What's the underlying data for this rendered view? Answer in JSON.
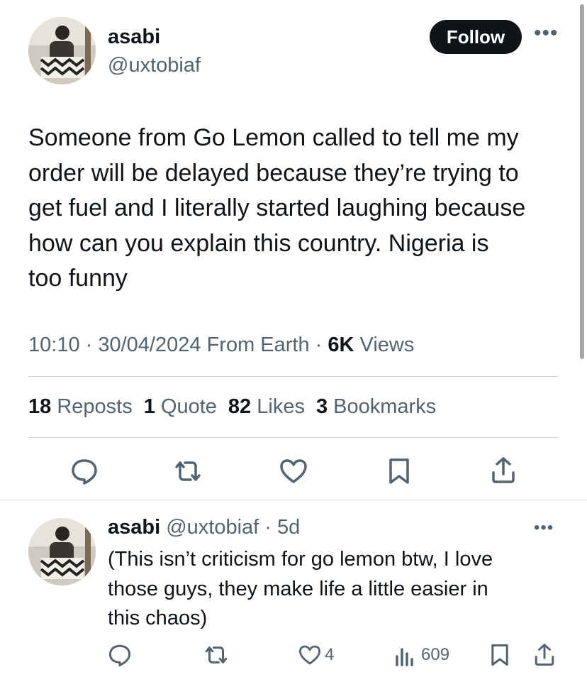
{
  "tweet": {
    "name": "asabi",
    "handle": "@uxtobiaf",
    "follow_label": "Follow",
    "text": "Someone from Go Lemon called to tell me my\norder will be delayed because they’re trying to\nget fuel and I literally started laughing because\nhow can you explain this country. Nigeria is\ntoo funny",
    "time": "10:10",
    "date": "30/04/2024",
    "source": "From Earth",
    "views_count": "6K",
    "views_label": "Views",
    "stats": {
      "reposts_count": "18",
      "reposts_label": "Reposts",
      "quotes_count": "1",
      "quotes_label": "Quote",
      "likes_count": "82",
      "likes_label": "Likes",
      "bookmarks_count": "3",
      "bookmarks_label": "Bookmarks"
    }
  },
  "reply": {
    "name": "asabi",
    "handle": "@uxtobiaf",
    "age": "5d",
    "text": "(This isn’t criticism for go lemon btw, I love\nthose guys, they make life  a little easier in\nthis chaos)",
    "likes": "4",
    "views": "609"
  },
  "colors": {
    "primary_text": "#0f1419",
    "secondary_text": "#536471",
    "divider": "#cfd9de"
  },
  "icons": [
    "reply-icon",
    "repost-icon",
    "like-icon",
    "bookmark-icon",
    "share-icon",
    "views-icon",
    "more-icon"
  ]
}
